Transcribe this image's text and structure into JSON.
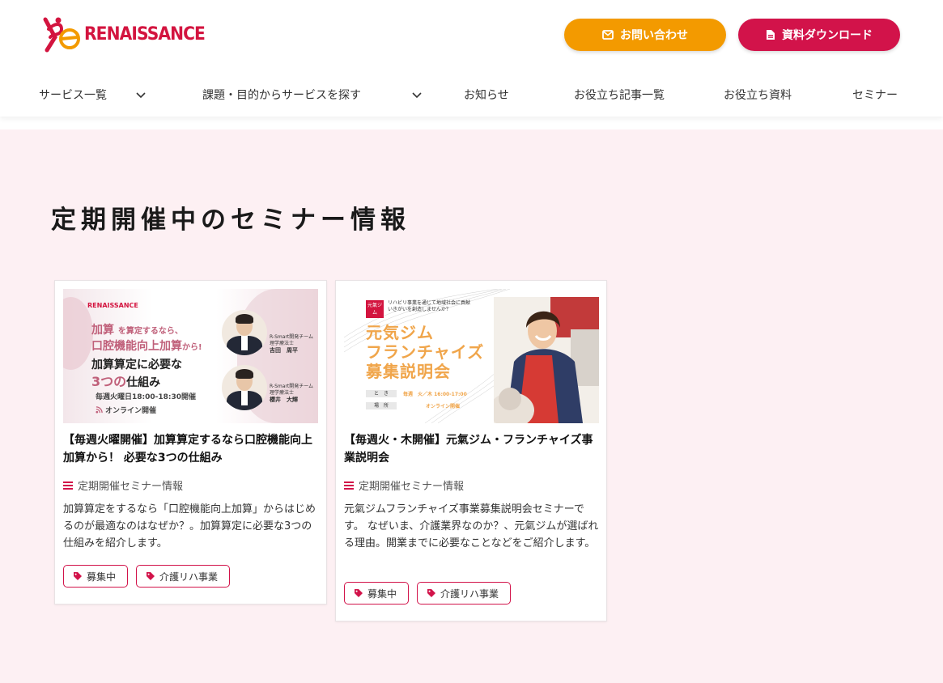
{
  "brand": {
    "name": "RENAISSANCE",
    "primary": "#d2134a",
    "accent": "#f39a00",
    "background_main": "#fdf0f3"
  },
  "header": {
    "contact_label": "お問い合わせ",
    "contact_icon": "envelope-icon",
    "download_label": "資料ダウンロード",
    "download_icon": "document-icon"
  },
  "nav": {
    "items": [
      {
        "label": "サービス一覧",
        "has_dropdown": true
      },
      {
        "label": "課題・目的からサービスを探す",
        "has_dropdown": true
      },
      {
        "label": "お知らせ",
        "has_dropdown": false
      },
      {
        "label": "お役立ち記事一覧",
        "has_dropdown": false
      },
      {
        "label": "お役立ち資料",
        "has_dropdown": false
      },
      {
        "label": "セミナー",
        "has_dropdown": false
      }
    ]
  },
  "section": {
    "title": "定期開催中のセミナー情報"
  },
  "cards": [
    {
      "title": "【毎週火曜開催】加算算定するなら口腔機能向上加算から！ 必要な3つの仕組み",
      "category": "定期開催セミナー情報",
      "description": "加算算定をするなら「口腔機能向上加算」からはじめるのが最適なのはなぜか？。加算算定に必要な3つの仕組みを紹介します。",
      "tags": [
        "募集中",
        "介護リハ事業"
      ],
      "thumb": {
        "logo": "RENAISSANCE",
        "line1_a": "加算",
        "line1_b": "を算定するなら、",
        "line2_a": "口腔機能向上加算",
        "line2_b": "から!",
        "line3": "加算算定に必要な",
        "line4_a": "3つの",
        "line4_b": "仕組み",
        "schedule": "毎週火曜日18:00-18:30開催",
        "online": "オンライン開催",
        "speaker1_team": "R-Smart開発チーム",
        "speaker1_role": "理学療法士",
        "speaker1_name": "吉田　周平",
        "speaker2_team": "R-Smart開発チーム",
        "speaker2_role": "理学療法士",
        "speaker2_name": "櫻井　大輝"
      }
    },
    {
      "title": "【毎週火・木開催】元氣ジム・フランチャイズ事業説明会",
      "category": "定期開催セミナー情報",
      "description": "元氣ジムフランチャイズ事業募集説明会セミナーです。 なぜいま、介護業界なのか？、元氣ジムが選ばれる理由。開業までに必要なことなどをご紹介します。",
      "tags": [
        "募集中",
        "介護リハ事業"
      ],
      "thumb": {
        "badge": "元氣ジム",
        "sub1": "リハビリ事業を通じて地域社会に貢献",
        "sub2": "いきがいを創造しませんか？",
        "big1": "元気ジム",
        "big2": "フランチャイズ",
        "big3": "募集説明会",
        "when_label": "と　き",
        "when_value": "毎週　火／木 16:00-17:00",
        "where_label": "場　所",
        "where_value": "オンライン開催"
      }
    }
  ]
}
